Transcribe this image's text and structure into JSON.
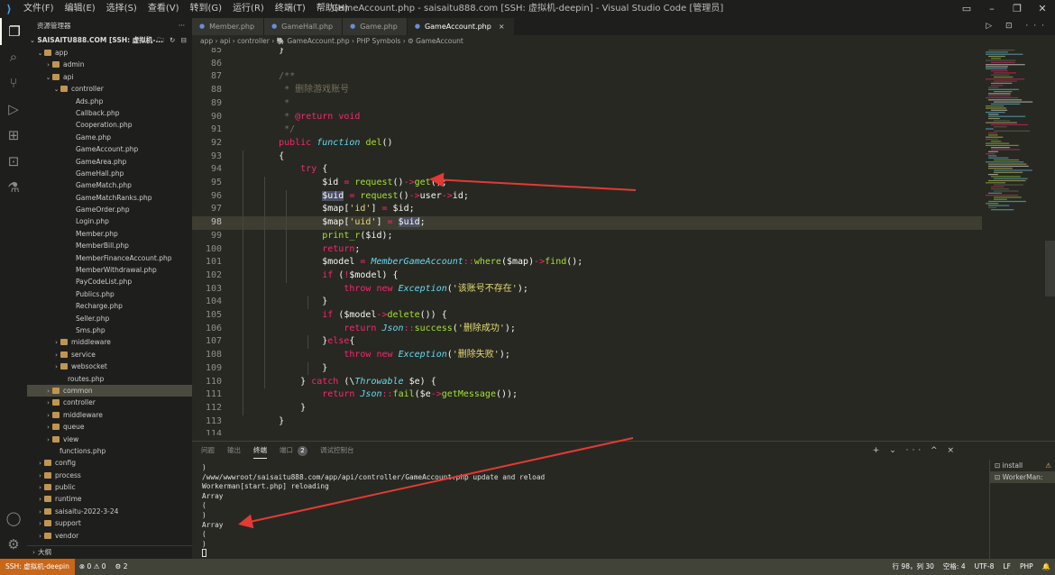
{
  "titlebar": {
    "logo": "vscode-logo",
    "menu": [
      "文件(F)",
      "编辑(E)",
      "选择(S)",
      "查看(V)",
      "转到(G)",
      "运行(R)",
      "终端(T)",
      "帮助(H)"
    ],
    "title": "GameAccount.php - saisaitu888.com [SSH: 虚拟机-deepin] - Visual Studio Code [管理员]",
    "controls": [
      "layout-icon",
      "minimize-icon",
      "maximize-icon",
      "close-icon"
    ]
  },
  "activity": [
    "explorer-icon",
    "search-icon",
    "source-control-icon",
    "run-debug-icon",
    "extensions-icon",
    "remote-explorer-icon",
    "testing-icon",
    "accounts-icon",
    "settings-gear-icon"
  ],
  "sidebar": {
    "title": "资源管理器",
    "more": "···",
    "root": "SAISAITU888.COM [SSH: 虚拟机-...",
    "root_tools": "🗋 🗀 ↻ ⊟",
    "items": [
      {
        "label": "app",
        "depth": 0,
        "kind": "folder",
        "expanded": true
      },
      {
        "label": "admin",
        "depth": 1,
        "kind": "folder",
        "expanded": false
      },
      {
        "label": "api",
        "depth": 1,
        "kind": "folder",
        "expanded": true
      },
      {
        "label": "controller",
        "depth": 2,
        "kind": "folder",
        "expanded": true
      },
      {
        "label": "Ads.php",
        "depth": 3,
        "kind": "php"
      },
      {
        "label": "Callback.php",
        "depth": 3,
        "kind": "php"
      },
      {
        "label": "Cooperation.php",
        "depth": 3,
        "kind": "php"
      },
      {
        "label": "Game.php",
        "depth": 3,
        "kind": "php"
      },
      {
        "label": "GameAccount.php",
        "depth": 3,
        "kind": "php"
      },
      {
        "label": "GameArea.php",
        "depth": 3,
        "kind": "php"
      },
      {
        "label": "GameHall.php",
        "depth": 3,
        "kind": "php"
      },
      {
        "label": "GameMatch.php",
        "depth": 3,
        "kind": "php"
      },
      {
        "label": "GameMatchRanks.php",
        "depth": 3,
        "kind": "php"
      },
      {
        "label": "GameOrder.php",
        "depth": 3,
        "kind": "php"
      },
      {
        "label": "Login.php",
        "depth": 3,
        "kind": "php"
      },
      {
        "label": "Member.php",
        "depth": 3,
        "kind": "php"
      },
      {
        "label": "MemberBill.php",
        "depth": 3,
        "kind": "php"
      },
      {
        "label": "MemberFinanceAccount.php",
        "depth": 3,
        "kind": "php"
      },
      {
        "label": "MemberWithdrawal.php",
        "depth": 3,
        "kind": "php"
      },
      {
        "label": "PayCodeList.php",
        "depth": 3,
        "kind": "php"
      },
      {
        "label": "Publics.php",
        "depth": 3,
        "kind": "php"
      },
      {
        "label": "Recharge.php",
        "depth": 3,
        "kind": "php"
      },
      {
        "label": "Seller.php",
        "depth": 3,
        "kind": "php"
      },
      {
        "label": "Sms.php",
        "depth": 3,
        "kind": "php"
      },
      {
        "label": "middleware",
        "depth": 2,
        "kind": "folder",
        "expanded": false
      },
      {
        "label": "service",
        "depth": 2,
        "kind": "folder",
        "expanded": false
      },
      {
        "label": "websocket",
        "depth": 2,
        "kind": "folder",
        "expanded": false
      },
      {
        "label": "routes.php",
        "depth": 2,
        "kind": "php"
      },
      {
        "label": "common",
        "depth": 1,
        "kind": "folder",
        "expanded": false,
        "selected": true
      },
      {
        "label": "controller",
        "depth": 1,
        "kind": "folder",
        "expanded": false
      },
      {
        "label": "middleware",
        "depth": 1,
        "kind": "folder",
        "expanded": false
      },
      {
        "label": "queue",
        "depth": 1,
        "kind": "folder",
        "expanded": false
      },
      {
        "label": "view",
        "depth": 1,
        "kind": "folder",
        "expanded": false
      },
      {
        "label": "functions.php",
        "depth": 1,
        "kind": "php"
      },
      {
        "label": "config",
        "depth": 0,
        "kind": "folder",
        "expanded": false
      },
      {
        "label": "process",
        "depth": 0,
        "kind": "folder",
        "expanded": false
      },
      {
        "label": "public",
        "depth": 0,
        "kind": "folder",
        "expanded": false
      },
      {
        "label": "runtime",
        "depth": 0,
        "kind": "folder",
        "expanded": false
      },
      {
        "label": "saisaitu-2022-3-24",
        "depth": 0,
        "kind": "folder",
        "expanded": false
      },
      {
        "label": "support",
        "depth": 0,
        "kind": "folder",
        "expanded": false
      },
      {
        "label": "vendor",
        "depth": 0,
        "kind": "folder",
        "expanded": false
      }
    ],
    "outline": "大纲"
  },
  "tabs": [
    {
      "label": "Member.php",
      "active": false
    },
    {
      "label": "GameHall.php",
      "active": false
    },
    {
      "label": "Game.php",
      "active": false
    },
    {
      "label": "GameAccount.php",
      "active": true
    }
  ],
  "tab_close": "×",
  "editor_actions": "▷ ⊡ ···",
  "breadcrumb": "app › api › controller › 🐘 GameAccount.php › PHP Symbols › ⚙ GameAccount",
  "editor": {
    "current_line": 98,
    "lines": [
      {
        "n": "85",
        "tokens": [
          [
            "pn",
            "    }"
          ]
        ]
      },
      {
        "n": "86",
        "tokens": [
          [
            "pl",
            ""
          ]
        ]
      },
      {
        "n": "87",
        "tokens": [
          [
            "cm",
            "    /**"
          ]
        ]
      },
      {
        "n": "88",
        "tokens": [
          [
            "cm",
            "     * 删除游戏账号"
          ]
        ]
      },
      {
        "n": "89",
        "tokens": [
          [
            "cm",
            "     *"
          ]
        ]
      },
      {
        "n": "90",
        "tokens": [
          [
            "cm",
            "     * "
          ],
          [
            "ann",
            "@return"
          ],
          [
            "cm",
            " "
          ],
          [
            "ann",
            "void"
          ]
        ]
      },
      {
        "n": "91",
        "tokens": [
          [
            "cm",
            "     */"
          ]
        ]
      },
      {
        "n": "92",
        "tokens": [
          [
            "mod",
            "    public"
          ],
          [
            "pl",
            " "
          ],
          [
            "sto",
            "function"
          ],
          [
            "pl",
            " "
          ],
          [
            "fn",
            "del"
          ],
          [
            "pn",
            "()"
          ]
        ]
      },
      {
        "n": "93",
        "tokens": [
          [
            "pn",
            "    {"
          ]
        ]
      },
      {
        "n": "94",
        "tokens": [
          [
            "kw",
            "        try"
          ],
          [
            "pn",
            " {"
          ]
        ]
      },
      {
        "n": "95",
        "tokens": [
          [
            "var",
            "            $id"
          ],
          [
            "op",
            " = "
          ],
          [
            "fn",
            "request"
          ],
          [
            "pn",
            "()"
          ],
          [
            "op",
            "->"
          ],
          [
            "fn",
            "get"
          ],
          [
            "pn",
            "();"
          ]
        ]
      },
      {
        "n": "96",
        "tokens": [
          [
            "pl",
            "            "
          ],
          [
            "hl",
            "$uid"
          ],
          [
            "op",
            " = "
          ],
          [
            "fn",
            "request"
          ],
          [
            "pn",
            "()"
          ],
          [
            "op",
            "->"
          ],
          [
            "var",
            "user"
          ],
          [
            "op",
            "->"
          ],
          [
            "var",
            "id"
          ],
          [
            "pn",
            ";"
          ]
        ]
      },
      {
        "n": "97",
        "tokens": [
          [
            "var",
            "            $map"
          ],
          [
            "pn",
            "["
          ],
          [
            "str",
            "'id'"
          ],
          [
            "pn",
            "]"
          ],
          [
            "op",
            " = "
          ],
          [
            "var",
            "$id"
          ],
          [
            "pn",
            ";"
          ]
        ]
      },
      {
        "n": "98",
        "tokens": [
          [
            "var",
            "            $map"
          ],
          [
            "pn",
            "["
          ],
          [
            "str",
            "'uid'"
          ],
          [
            "pn",
            "]"
          ],
          [
            "op",
            " = "
          ],
          [
            "hl",
            "$uid"
          ],
          [
            "pn",
            ";"
          ]
        ]
      },
      {
        "n": "99",
        "tokens": [
          [
            "fn",
            "            print_r"
          ],
          [
            "pn",
            "("
          ],
          [
            "var",
            "$id"
          ],
          [
            "pn",
            ");"
          ]
        ]
      },
      {
        "n": "100",
        "tokens": [
          [
            "kw",
            "            return"
          ],
          [
            "pn",
            ";"
          ]
        ]
      },
      {
        "n": "101",
        "tokens": [
          [
            "var",
            "            $model"
          ],
          [
            "op",
            " = "
          ],
          [
            "cls",
            "MemberGameAccount"
          ],
          [
            "op",
            "::"
          ],
          [
            "fn",
            "where"
          ],
          [
            "pn",
            "("
          ],
          [
            "var",
            "$map"
          ],
          [
            "pn",
            ")"
          ],
          [
            "op",
            "->"
          ],
          [
            "fn",
            "find"
          ],
          [
            "pn",
            "();"
          ]
        ]
      },
      {
        "n": "102",
        "tokens": [
          [
            "kw",
            "            if"
          ],
          [
            "pn",
            " ("
          ],
          [
            "op",
            "!"
          ],
          [
            "var",
            "$model"
          ],
          [
            "pn",
            ") {"
          ]
        ]
      },
      {
        "n": "103",
        "tokens": [
          [
            "kw",
            "                throw"
          ],
          [
            "pl",
            " "
          ],
          [
            "kw",
            "new"
          ],
          [
            "pl",
            " "
          ],
          [
            "cls",
            "Exception"
          ],
          [
            "pn",
            "("
          ],
          [
            "str",
            "'该账号不存在'"
          ],
          [
            "pn",
            ");"
          ]
        ]
      },
      {
        "n": "104",
        "tokens": [
          [
            "pn",
            "            }"
          ]
        ]
      },
      {
        "n": "105",
        "tokens": [
          [
            "kw",
            "            if"
          ],
          [
            "pn",
            " ("
          ],
          [
            "var",
            "$model"
          ],
          [
            "op",
            "->"
          ],
          [
            "fn",
            "delete"
          ],
          [
            "pn",
            "()) {"
          ]
        ]
      },
      {
        "n": "106",
        "tokens": [
          [
            "kw",
            "                return"
          ],
          [
            "pl",
            " "
          ],
          [
            "cls",
            "Json"
          ],
          [
            "op",
            "::"
          ],
          [
            "fn",
            "success"
          ],
          [
            "pn",
            "("
          ],
          [
            "str",
            "'删除成功'"
          ],
          [
            "pn",
            ");"
          ]
        ]
      },
      {
        "n": "107",
        "tokens": [
          [
            "pn",
            "            }"
          ],
          [
            "kw",
            "else"
          ],
          [
            "pn",
            "{"
          ]
        ]
      },
      {
        "n": "108",
        "tokens": [
          [
            "kw",
            "                throw"
          ],
          [
            "pl",
            " "
          ],
          [
            "kw",
            "new"
          ],
          [
            "pl",
            " "
          ],
          [
            "cls",
            "Exception"
          ],
          [
            "pn",
            "("
          ],
          [
            "str",
            "'删除失败'"
          ],
          [
            "pn",
            ");"
          ]
        ]
      },
      {
        "n": "109",
        "tokens": [
          [
            "pn",
            "            }"
          ]
        ]
      },
      {
        "n": "110",
        "tokens": [
          [
            "pn",
            "        } "
          ],
          [
            "kw",
            "catch"
          ],
          [
            "pn",
            " (\\"
          ],
          [
            "cls",
            "Throwable"
          ],
          [
            "pl",
            " "
          ],
          [
            "var",
            "$e"
          ],
          [
            "pn",
            ") {"
          ]
        ]
      },
      {
        "n": "111",
        "tokens": [
          [
            "kw",
            "            return"
          ],
          [
            "pl",
            " "
          ],
          [
            "cls",
            "Json"
          ],
          [
            "op",
            "::"
          ],
          [
            "fn",
            "fail"
          ],
          [
            "pn",
            "("
          ],
          [
            "var",
            "$e"
          ],
          [
            "op",
            "->"
          ],
          [
            "fn",
            "getMessage"
          ],
          [
            "pn",
            "());"
          ]
        ]
      },
      {
        "n": "112",
        "tokens": [
          [
            "pn",
            "        }"
          ]
        ]
      },
      {
        "n": "113",
        "tokens": [
          [
            "pn",
            "    }"
          ]
        ]
      },
      {
        "n": "114",
        "tokens": [
          [
            "pl",
            ""
          ]
        ]
      }
    ]
  },
  "panel": {
    "tabs": [
      {
        "label": "问题",
        "active": false
      },
      {
        "label": "输出",
        "active": false
      },
      {
        "label": "终端",
        "active": true
      },
      {
        "label": "端口",
        "active": false,
        "badge": "2"
      },
      {
        "label": "调试控制台",
        "active": false
      }
    ],
    "actions": "+ ⌄ ··· ^ ×",
    "terminal_lines": [
      ")",
      "/www/wwwroot/saisaitu888.com/app/api/controller/GameAccount.php update and reload",
      "Workerman[start.php] reloading",
      "Array",
      "(",
      ")",
      "Array",
      "(",
      ")"
    ],
    "terminal_list": [
      {
        "label": "install",
        "active": false,
        "warn": "⚠"
      },
      {
        "label": "WorkerMan:",
        "active": true
      }
    ]
  },
  "statusbar": {
    "remote": "SSH: 虚拟机-deepin",
    "problems": "⊗ 0 ⚠ 0",
    "ports": "⚙ 2",
    "position": "行 98，列 30",
    "spaces": "空格: 4",
    "encoding": "UTF-8",
    "eol": "LF",
    "language": "PHP"
  },
  "colors": {
    "annotation_arrow": "#e53935",
    "accent": "#c8671a"
  }
}
